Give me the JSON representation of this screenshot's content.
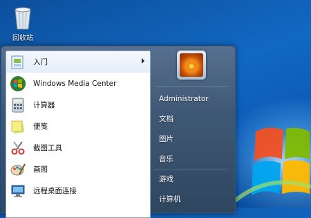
{
  "desktop": {
    "recycle_bin_label": "回收站",
    "recycle_bin_icon": "recycle-bin-icon"
  },
  "start_menu": {
    "programs": [
      {
        "label": "入门",
        "icon": "getting-started-icon",
        "has_submenu": true
      },
      {
        "label": "Windows Media Center",
        "icon": "media-center-icon",
        "has_submenu": false
      },
      {
        "label": "计算器",
        "icon": "calculator-icon",
        "has_submenu": false
      },
      {
        "label": "便笺",
        "icon": "sticky-notes-icon",
        "has_submenu": false
      },
      {
        "label": "截图工具",
        "icon": "snipping-tool-icon",
        "has_submenu": false
      },
      {
        "label": "画图",
        "icon": "paint-icon",
        "has_submenu": false
      },
      {
        "label": "远程桌面连接",
        "icon": "remote-desktop-icon",
        "has_submenu": false
      }
    ],
    "user": {
      "name": "Administrator",
      "avatar_icon": "flower-avatar-icon"
    },
    "right_items": [
      {
        "label": "文档"
      },
      {
        "label": "图片"
      },
      {
        "label": "音乐"
      },
      {
        "label": "游戏"
      },
      {
        "label": "计算机"
      }
    ]
  },
  "colors": {
    "desktop_blue": "#1268c2",
    "menu_frame": "#3f5875",
    "left_pane": "#ffffff"
  }
}
